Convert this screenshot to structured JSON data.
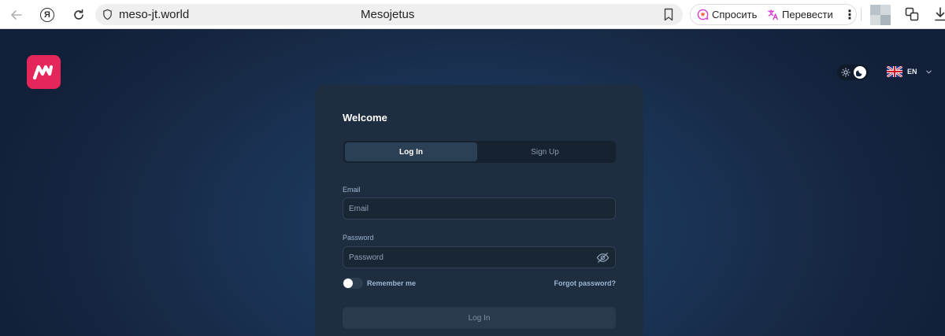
{
  "browser": {
    "url": "meso-jt.world",
    "tab_title": "Mesojetus",
    "yandex_glyph": "Я",
    "ask_label": "Спросить",
    "translate_label": "Перевести",
    "more_glyph": "⋮"
  },
  "header": {
    "logo_icon": "mesojetus-logo-icon",
    "theme_toggle_state": "dark",
    "language_code": "EN",
    "language_flag": "uk-flag-icon"
  },
  "login_card": {
    "title": "Welcome",
    "tabs": [
      {
        "label": "Log In",
        "active": true
      },
      {
        "label": "Sign Up",
        "active": false
      }
    ],
    "email_label": "Email",
    "email_placeholder": "Email",
    "password_label": "Password",
    "password_placeholder": "Password",
    "remember_label": "Remember me",
    "remember_checked": false,
    "forgot_label": "Forgot password?",
    "submit_label": "Log In"
  },
  "colors": {
    "brand": "#e4265a",
    "card_bg": "#1e2e40",
    "page_bg": "#1a3354",
    "label": "#9cb5d1"
  }
}
